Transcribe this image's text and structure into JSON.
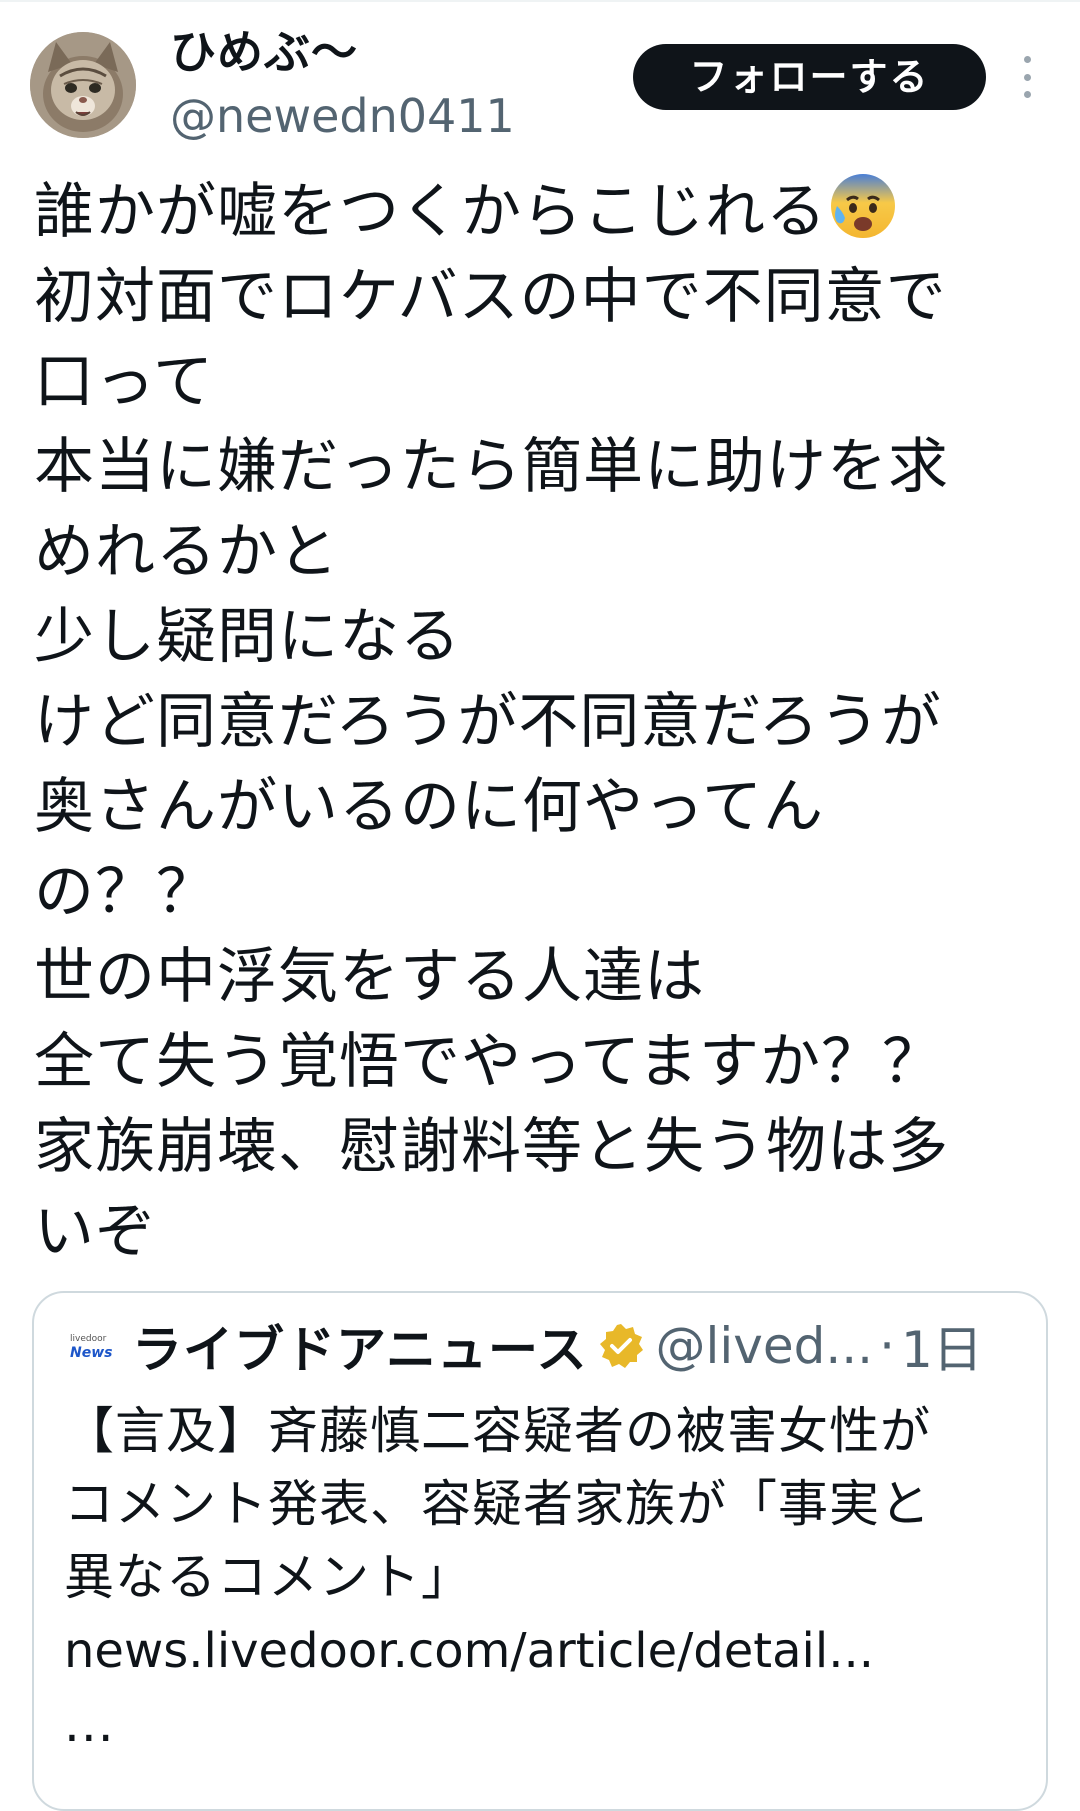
{
  "author": {
    "display_name": "ひめぶ〜",
    "handle": "@newedn0411",
    "avatar_icon": "cat-photo-avatar"
  },
  "actions": {
    "follow_label": "フォローする",
    "more_icon": "vertical-ellipsis-icon"
  },
  "tweet": {
    "lines": [
      "誰かが嘘をつくからこじれる",
      "初対面でロケバスの中で不同意で",
      "口って",
      "本当に嫌だったら簡単に助けを求",
      "めれるかと",
      "少し疑問になる",
      "けど同意だろうが不同意だろうが",
      "奥さんがいるのに何やってん",
      "の？？",
      "世の中浮気をする人達は",
      "全て失う覚悟でやってますか？？",
      "家族崩壊、慰謝料等と失う物は多",
      "いぞ"
    ],
    "emoji": "anxious-face-with-sweat-icon"
  },
  "quote": {
    "logo_small": "livedoor",
    "logo_text": "News",
    "author_name": "ライブドアニュース",
    "verified_icon": "gold-verified-badge-icon",
    "handle": "@lived...",
    "separator": "·",
    "time": "1日",
    "text_lines": [
      "【言及】斉藤慎二容疑者の被害女性が",
      "コメント発表、容疑者家族が「事実と",
      "異なるコメント」"
    ],
    "link": "news.livedoor.com/article/detail...",
    "ellipsis": "..."
  },
  "colors": {
    "text_primary": "#0f1419",
    "text_secondary": "#536471",
    "border": "#cfd9de",
    "follow_bg": "#0f1419",
    "verified_gold": "#e8b829"
  }
}
